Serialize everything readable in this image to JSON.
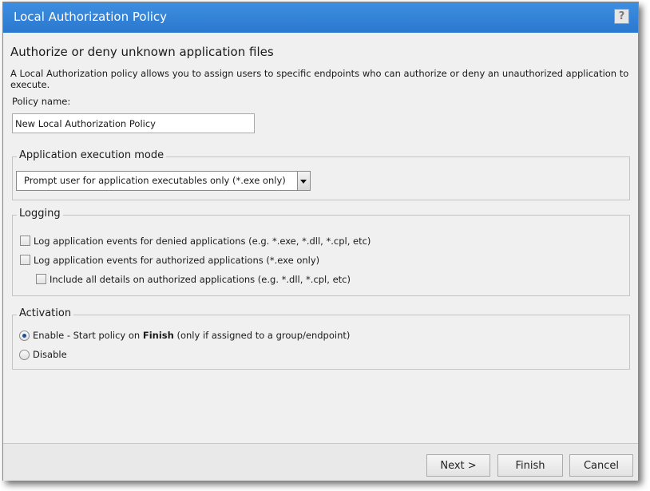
{
  "dialog": {
    "title": "Local Authorization Policy",
    "help_label": "?"
  },
  "content": {
    "heading": "Authorize or deny unknown application files",
    "description": "A Local Authorization policy allows you to assign users to specific endpoints who can authorize or deny an unauthorized application to execute.",
    "policy_name_label": "Policy name:",
    "policy_name_value": "New Local Authorization Policy"
  },
  "execution_mode": {
    "legend": "Application execution mode",
    "selected": "Prompt user for application executables only (*.exe only)"
  },
  "logging": {
    "legend": "Logging",
    "options": [
      {
        "label": "Log application events for denied applications (e.g. *.exe, *.dll, *.cpl, etc)",
        "checked": false
      },
      {
        "label": "Log application events for authorized applications (*.exe only)",
        "checked": false
      },
      {
        "label": "Include all details on authorized applications (e.g. *.dll, *.cpl, etc)",
        "checked": false
      }
    ]
  },
  "activation": {
    "legend": "Activation",
    "enable_prefix": "Enable - Start policy on ",
    "enable_bold": "Finish",
    "enable_suffix": " (only if assigned to a group/endpoint)",
    "disable_label": "Disable",
    "selected": "enable"
  },
  "footer": {
    "next_label": "Next >",
    "finish_label": "Finish",
    "cancel_label": "Cancel"
  },
  "colors": {
    "titlebar": "#2a78cf",
    "dialog_bg": "#f0f0f0"
  }
}
